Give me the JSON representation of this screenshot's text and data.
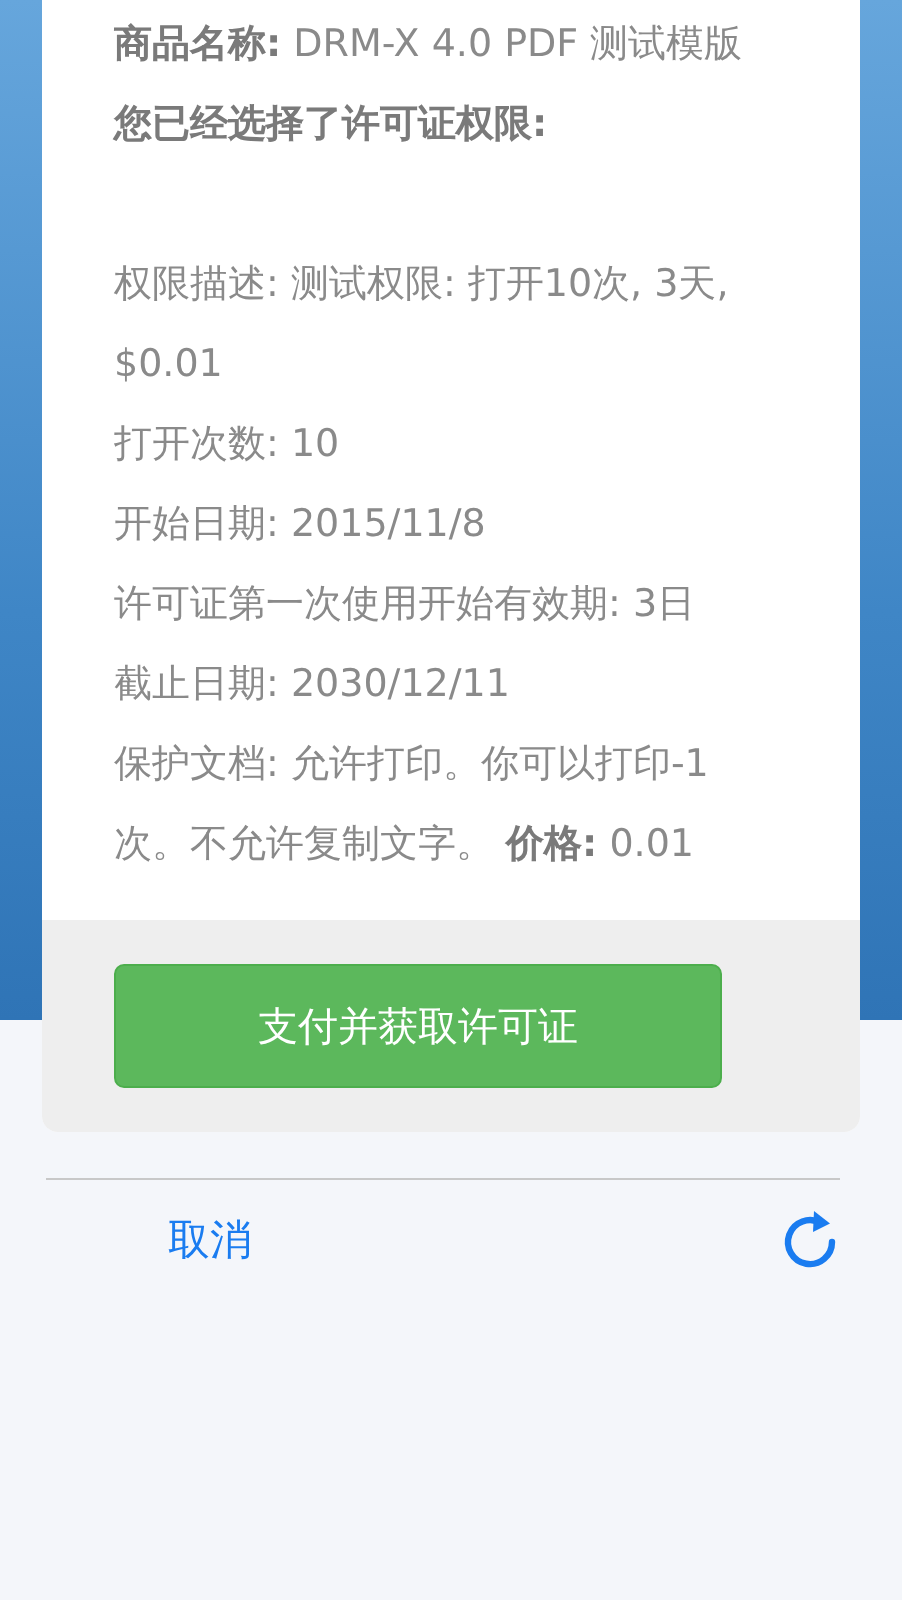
{
  "product": {
    "label": "商品名称:",
    "value": "DRM-X 4.0 PDF 测试模版"
  },
  "heading": "您已经选择了许可证权限:",
  "details": [
    "权限描述: 测试权限: 打开10次, 3天, $0.01",
    "打开次数: 10",
    "开始日期: 2015/11/8",
    "许可证第一次使用开始有效期: 3日",
    "截止日期: 2030/12/11",
    "保护文档: 允许打印。你可以打印-1次。不允许复制文字。 **价格:** 0.01"
  ],
  "pay_button": "支付并获取许可证",
  "cancel_link": "取消"
}
